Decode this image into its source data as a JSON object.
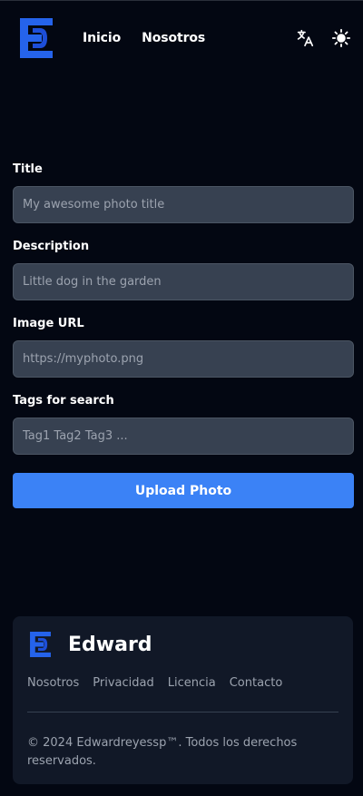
{
  "header": {
    "logo_alt": "ED",
    "nav": [
      {
        "label": "Inicio"
      },
      {
        "label": "Nosotros"
      }
    ],
    "translate_icon": "translate-icon",
    "theme_icon": "sun-icon"
  },
  "form": {
    "title": {
      "label": "Title",
      "placeholder": "My awesome photo title"
    },
    "description": {
      "label": "Description",
      "placeholder": "Little dog in the garden"
    },
    "image_url": {
      "label": "Image URL",
      "placeholder": "https://myphoto.png"
    },
    "tags": {
      "label": "Tags for search",
      "placeholder": "Tag1 Tag2 Tag3 ..."
    },
    "submit_label": "Upload Photo"
  },
  "footer": {
    "brand_name": "Edward",
    "links": [
      {
        "label": "Nosotros"
      },
      {
        "label": "Privacidad"
      },
      {
        "label": "Licencia"
      },
      {
        "label": "Contacto"
      }
    ],
    "copyright": "© 2024 Edwardreyessp™. Todos los derechos reservados."
  },
  "colors": {
    "background": "#030712",
    "input_bg": "#374151",
    "accent": "#3b82f6",
    "footer_bg": "#111827",
    "muted_text": "#9ca3af",
    "logo_blue": "#2563eb"
  }
}
